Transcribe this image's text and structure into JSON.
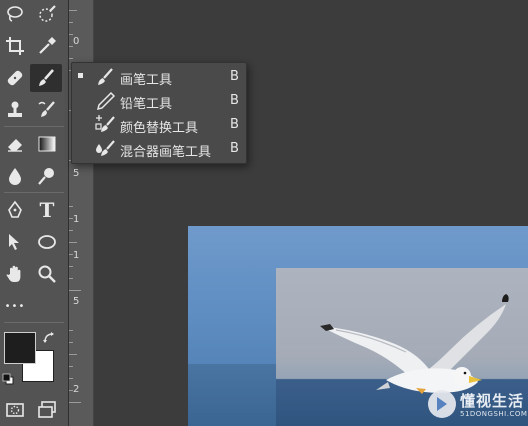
{
  "toolbar": {
    "tools": [
      {
        "name": "lasso-tool-icon"
      },
      {
        "name": "quick-selection-tool-icon"
      },
      {
        "name": "crop-tool-icon"
      },
      {
        "name": "eyedropper-tool-icon"
      },
      {
        "name": "healing-brush-tool-icon"
      },
      {
        "name": "brush-tool-icon",
        "active": true
      },
      {
        "name": "clone-stamp-tool-icon"
      },
      {
        "name": "history-brush-tool-icon"
      },
      {
        "name": "eraser-tool-icon"
      },
      {
        "name": "gradient-tool-icon"
      },
      {
        "name": "blur-tool-icon"
      },
      {
        "name": "dodge-tool-icon"
      },
      {
        "name": "pen-tool-icon"
      },
      {
        "name": "type-tool-icon"
      },
      {
        "name": "path-selection-tool-icon"
      },
      {
        "name": "ellipse-tool-icon"
      },
      {
        "name": "hand-tool-icon"
      },
      {
        "name": "zoom-tool-icon"
      },
      {
        "name": "more-tools-icon"
      },
      {
        "name": "edit-toolbar-icon"
      }
    ],
    "type_tool_glyph": "T",
    "more_glyph": "•••",
    "colors": {
      "foreground": "#1e1e1e",
      "background": "#ffffff"
    }
  },
  "ruler": {
    "numbers": [
      "0",
      "5",
      "1",
      "1",
      "5",
      "2"
    ]
  },
  "flyout": {
    "items": [
      {
        "label": "画笔工具",
        "shortcut": "B",
        "selected": true,
        "icon": "brush-icon"
      },
      {
        "label": "铅笔工具",
        "shortcut": "B",
        "selected": false,
        "icon": "pencil-icon"
      },
      {
        "label": "颜色替换工具",
        "shortcut": "B",
        "selected": false,
        "icon": "color-replacement-icon"
      },
      {
        "label": "混合器画笔工具",
        "shortcut": "B",
        "selected": false,
        "icon": "mixer-brush-icon"
      }
    ]
  },
  "watermark": {
    "text": "懂视生活",
    "subtext": "51DONGSHI.COM"
  }
}
